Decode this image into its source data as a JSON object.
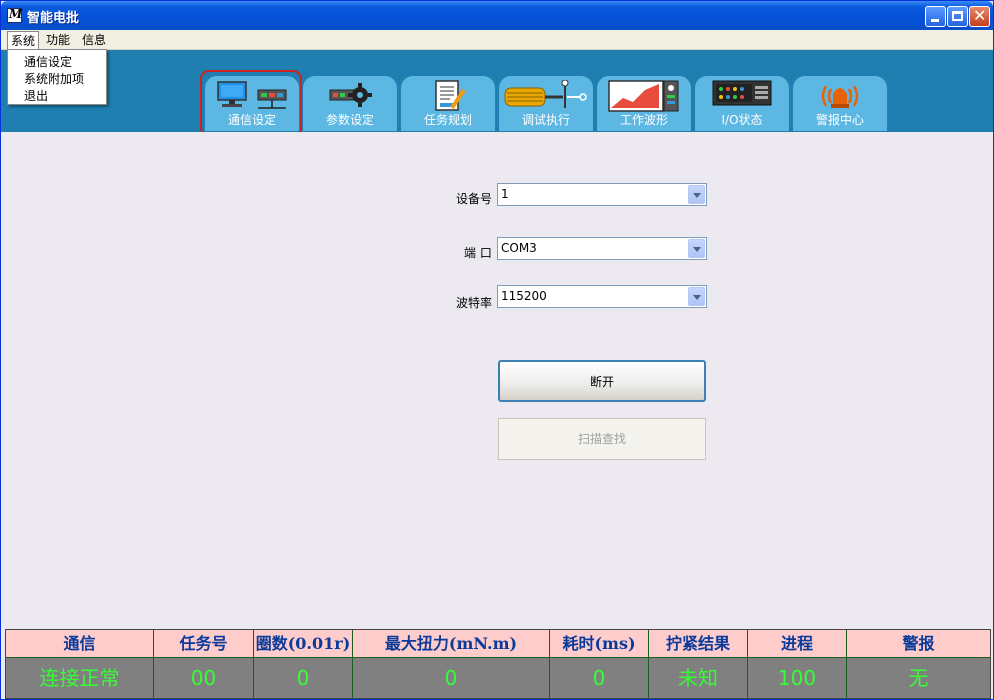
{
  "window": {
    "title": "智能电批"
  },
  "menu": {
    "items": [
      "系统",
      "功能",
      "信息"
    ]
  },
  "dropdown": {
    "items": [
      "通信设定",
      "系统附加项",
      "退出"
    ]
  },
  "tabs": [
    {
      "label": "通信设定",
      "icon": "computer-icon",
      "selected": true
    },
    {
      "label": "参数设定",
      "icon": "gear-device-icon"
    },
    {
      "label": "任务规划",
      "icon": "document-edit-icon"
    },
    {
      "label": "调试执行",
      "icon": "screwdriver-icon"
    },
    {
      "label": "工作波形",
      "icon": "waveform-icon"
    },
    {
      "label": "I/O状态",
      "icon": "io-panel-icon"
    },
    {
      "label": "警报中心",
      "icon": "alarm-bell-icon"
    }
  ],
  "form": {
    "device": {
      "label": "设备号",
      "value": "1"
    },
    "port": {
      "label": "端 口",
      "value": "COM3"
    },
    "baud": {
      "label": "波特率",
      "value": "115200"
    },
    "disconnect_label": "断开",
    "scan_label": "扫描查找"
  },
  "status": {
    "columns": [
      "通信",
      "任务号",
      "圈数(0.01r)",
      "最大扭力(mN.m)",
      "耗时(ms)",
      "拧紧结果",
      "进程",
      "警报"
    ],
    "values": [
      "连接正常",
      "00",
      "0",
      "0",
      "0",
      "未知",
      "100",
      "无"
    ]
  },
  "colors": {
    "band": "#1E7FB0",
    "tab": "#5CB8E2",
    "status_header": "#FFCCCC",
    "status_value": "#33FF33"
  }
}
